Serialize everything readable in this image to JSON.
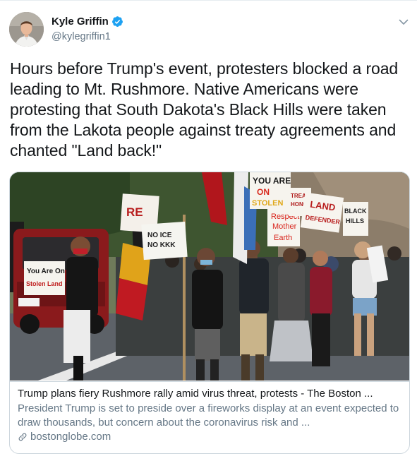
{
  "author": {
    "name": "Kyle Griffin",
    "handle": "@kylegriffin1",
    "verified": true
  },
  "tweet": {
    "text": "Hours before Trump's event, protesters blocked a road leading to Mt. Rushmore. Native Americans were protesting that South Dakota's Black Hills were taken from the Lakota people against treaty agreements and chanted \"Land back!\""
  },
  "card": {
    "signs": {
      "you_are_on": "YOU ARE",
      "on": "ON",
      "stolen": "STOLEN",
      "land": "LAND",
      "respect": "Respect",
      "mother": "Mother",
      "earth": "Earth",
      "land_defender_1": "LAND",
      "land_defender_2": "DEFENDER",
      "black_1": "BLACK",
      "black_2": "HILLS",
      "no_ice_1": "NO ICE",
      "no_ice_2": "NO KKK",
      "left_sign_1": "You Are On",
      "left_sign_2": "Stolen Land",
      "treaty_1": "TREAT",
      "treaty_2": "HONOR"
    },
    "title": "Trump plans fiery Rushmore rally amid virus threat, protests - The Boston ...",
    "description": "President Trump is set to preside over a fireworks display at an event expected to draw thousands, but concern about the coronavirus risk and ...",
    "domain": "bostonglobe.com"
  },
  "colors": {
    "verified": "#1da1f2",
    "secondary_text": "#657786",
    "border": "#ccd6dd"
  },
  "icons": {
    "verified": "verified-badge-icon",
    "caret": "chevron-down-icon",
    "link": "link-icon"
  }
}
